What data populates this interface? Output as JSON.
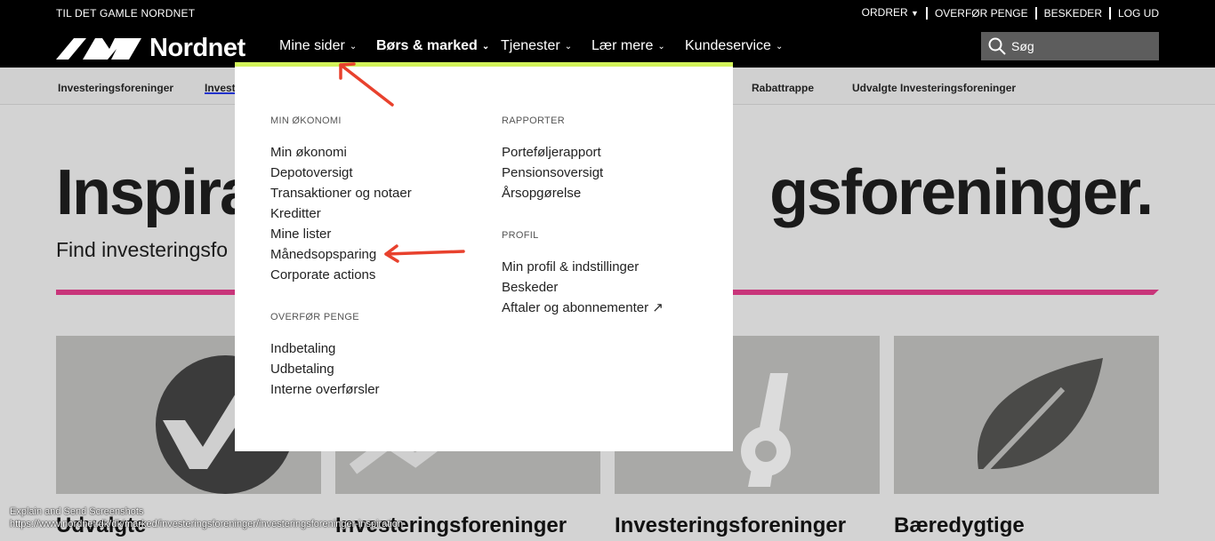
{
  "utility_bar": {
    "old_site": "TIL DET GAMLE NORDNET",
    "links": [
      "ORDRER",
      "OVERFØR PENGE",
      "BESKEDER",
      "LOG UD"
    ]
  },
  "nav": {
    "brand": "Nordnet",
    "items": [
      "Mine sider",
      "Børs & marked",
      "Tjenester",
      "Lær mere",
      "Kundeservice"
    ],
    "search_placeholder": "Søg"
  },
  "subnav": {
    "items": [
      "Investeringsforeninger",
      "Invest",
      "Rabattrappe",
      "Udvalgte Investeringsforeninger"
    ]
  },
  "page": {
    "hero_left": "Inspira",
    "hero_right": "gsforeninger.",
    "subtitle": "Find investeringsfo",
    "cards": [
      "Udvalgte",
      "Investeringsforeninger",
      "Investeringsforeninger",
      "Bæredygtige"
    ]
  },
  "dropdown": {
    "min_okonomi": {
      "title": "MIN ØKONOMI",
      "items": [
        "Min økonomi",
        "Depotoversigt",
        "Transaktioner og notaer",
        "Kreditter",
        "Mine lister",
        "Månedsopsparing",
        "Corporate actions"
      ]
    },
    "overfor_penge": {
      "title": "OVERFØR PENGE",
      "items": [
        "Indbetaling",
        "Udbetaling",
        "Interne overførsler"
      ]
    },
    "rapporter": {
      "title": "RAPPORTER",
      "items": [
        "Porteføljerapport",
        "Pensionsoversigt",
        "Årsopgørelse"
      ]
    },
    "profil": {
      "title": "PROFIL",
      "items": [
        "Min profil & indstillinger",
        "Beskeder",
        "Aftaler og abonnementer"
      ]
    }
  },
  "status": {
    "line1": "Explain and Send Screenshots",
    "line2": "https://www.nordnet.dk/dk/marked/investeringsforeninger/investeringsforeninger-inspiration"
  },
  "colors": {
    "accent_lime": "#d2f25a",
    "accent_pink": "#c8357a",
    "annotation_red": "#e8412d"
  }
}
